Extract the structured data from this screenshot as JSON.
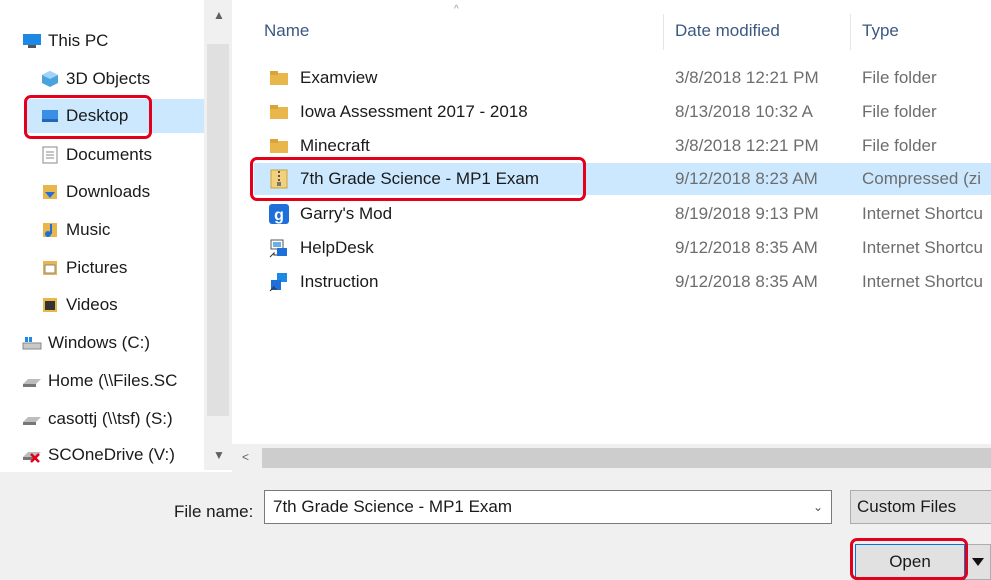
{
  "nav": {
    "items": [
      {
        "label": "This PC",
        "icon": "pc-icon"
      },
      {
        "label": "3D Objects",
        "icon": "3d-objects-icon"
      },
      {
        "label": "Desktop",
        "icon": "desktop-icon",
        "selected": true
      },
      {
        "label": "Documents",
        "icon": "documents-icon"
      },
      {
        "label": "Downloads",
        "icon": "downloads-icon"
      },
      {
        "label": "Music",
        "icon": "music-icon"
      },
      {
        "label": "Pictures",
        "icon": "pictures-icon"
      },
      {
        "label": "Videos",
        "icon": "videos-icon"
      },
      {
        "label": "Windows (C:)",
        "icon": "windows-drive-icon"
      },
      {
        "label": "Home (\\\\Files.SC",
        "icon": "network-drive-icon"
      },
      {
        "label": "casottj (\\\\tsf) (S:)",
        "icon": "network-drive-icon"
      },
      {
        "label": "SCOneDrive (V:)",
        "icon": "disconnected-drive-icon"
      }
    ]
  },
  "columns": {
    "name": "Name",
    "date": "Date modified",
    "type": "Type"
  },
  "files": [
    {
      "name": "Examview",
      "date": "3/8/2018 12:21 PM",
      "type": "File folder",
      "icon": "folder-icon"
    },
    {
      "name": "Iowa Assessment 2017 - 2018",
      "date": "8/13/2018 10:32 A",
      "type": "File folder",
      "icon": "folder-icon"
    },
    {
      "name": "Minecraft",
      "date": "3/8/2018 12:21 PM",
      "type": "File folder",
      "icon": "folder-icon"
    },
    {
      "name": "7th Grade Science - MP1 Exam",
      "date": "9/12/2018 8:23 AM",
      "type": "Compressed (zi",
      "icon": "zip-folder-icon",
      "selected": true
    },
    {
      "name": "Garry's Mod",
      "date": "8/19/2018 9:13 PM",
      "type": "Internet Shortcu",
      "icon": "garrys-mod-icon"
    },
    {
      "name": "HelpDesk",
      "date": "9/12/2018 8:35 AM",
      "type": "Internet Shortcu",
      "icon": "helpdesk-shortcut-icon"
    },
    {
      "name": "Instruction",
      "date": "9/12/2018 8:35 AM",
      "type": "Internet Shortcu",
      "icon": "instruction-shortcut-icon"
    }
  ],
  "footer": {
    "file_name_label": "File name:",
    "file_name_value": "7th Grade Science - MP1 Exam",
    "file_type": "Custom Files",
    "open_label": "Open"
  },
  "colors": {
    "selection": "#cce8ff",
    "highlight": "#e2001a",
    "folder": "#e8b64b"
  }
}
